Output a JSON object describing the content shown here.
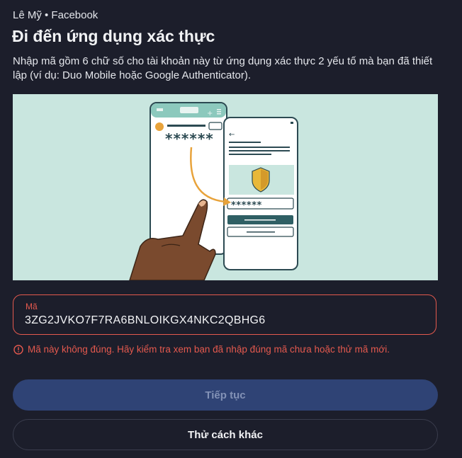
{
  "header": {
    "account": "Lê Mỹ • Facebook",
    "title": "Đi đến ứng dụng xác thực",
    "description": "Nhập mã gồm 6 chữ số cho tài khoản này từ ứng dụng xác thực 2 yếu tố mà bạn đã thiết lập (ví dụ: Duo Mobile hoặc Google Authenticator)."
  },
  "illustration": {
    "code_mask_left": "******",
    "code_mask_right": "******"
  },
  "code_field": {
    "label": "Mã",
    "value": "3ZG2JVKO7F7RA6BNLOIKGX4NKC2QBHG6"
  },
  "error": {
    "message": "Mã này không đúng. Hãy kiểm tra xem bạn đã nhập đúng mã chưa hoặc thử mã mới."
  },
  "buttons": {
    "continue": "Tiếp tục",
    "try_another": "Thử cách khác"
  },
  "colors": {
    "background": "#1c1e2b",
    "error": "#e4594e",
    "primary_button": "#2f4375",
    "illustration_bg": "#c9e6df"
  }
}
